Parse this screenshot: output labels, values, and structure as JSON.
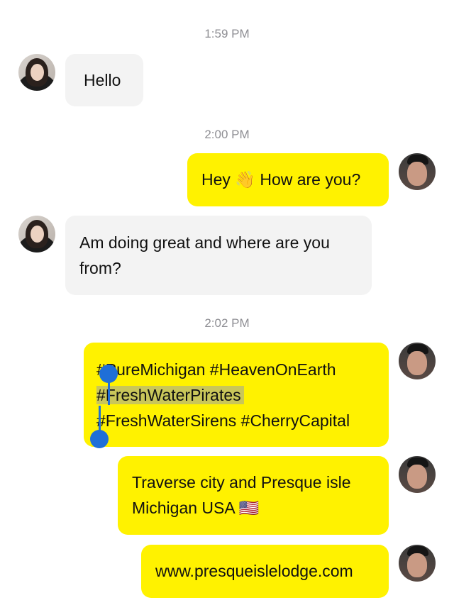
{
  "timestamps": [
    "1:59 PM",
    "2:00 PM",
    "2:02 PM"
  ],
  "messages": {
    "hello": "Hello",
    "hey_prefix": "Hey ",
    "hey_emoji": "👋",
    "hey_suffix": " How are you?",
    "where_line1": "Am doing great and where are you",
    "where_line2": "from?",
    "tags_line1": "#PureMichigan #HeavenOnEarth",
    "tags_line2": "#FreshWaterPirates",
    "tags_line3": "#FreshWaterSirens #CherryCapital",
    "location_line1": "Traverse city and Presque isle",
    "location_line2": "Michigan USA ",
    "location_flag": "🇺🇸",
    "url": "www.presqueislelodge.com"
  },
  "colors": {
    "outgoing_bubble": "#fff200",
    "incoming_bubble": "#f3f3f3",
    "selection_handle": "#1f6fd8",
    "timestamp": "#8e8e93"
  },
  "icons": {
    "wave": "waving-hand-emoji",
    "flag": "us-flag-emoji"
  }
}
